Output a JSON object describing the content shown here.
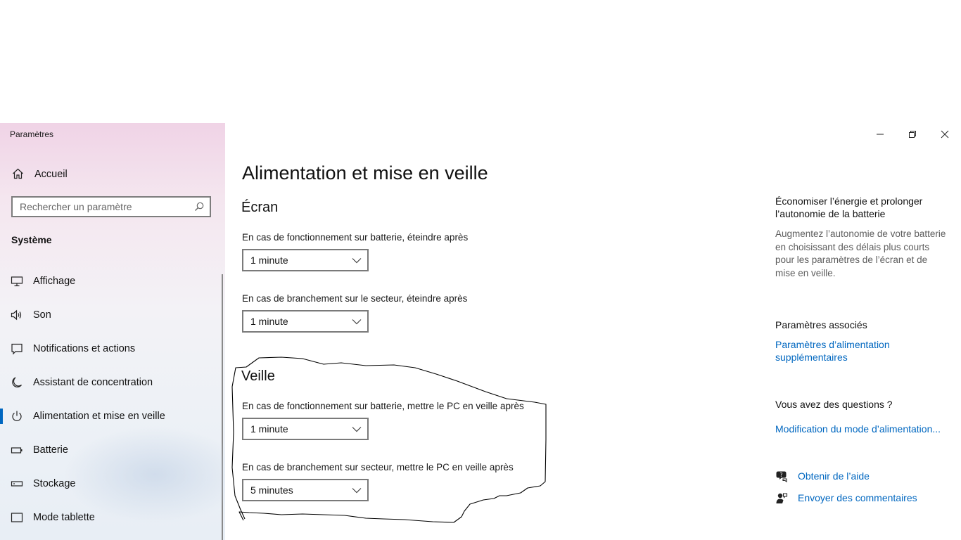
{
  "window": {
    "title": "Paramètres"
  },
  "sidebar": {
    "home_label": "Accueil",
    "search_placeholder": "Rechercher un paramètre",
    "section_label": "Système",
    "items": [
      {
        "label": "Affichage",
        "icon": "display-icon"
      },
      {
        "label": "Son",
        "icon": "speaker-icon"
      },
      {
        "label": "Notifications et actions",
        "icon": "notification-icon"
      },
      {
        "label": "Assistant de concentration",
        "icon": "moon-icon"
      },
      {
        "label": "Alimentation et mise en veille",
        "icon": "power-icon",
        "selected": true
      },
      {
        "label": "Batterie",
        "icon": "battery-icon"
      },
      {
        "label": "Stockage",
        "icon": "storage-icon"
      },
      {
        "label": "Mode tablette",
        "icon": "tablet-icon"
      }
    ]
  },
  "main": {
    "title": "Alimentation et mise en veille",
    "screen": {
      "heading": "Écran",
      "battery_label": "En cas de fonctionnement sur batterie, éteindre après",
      "battery_value": "1 minute",
      "plugged_label": "En cas de branchement sur le secteur, éteindre après",
      "plugged_value": "1 minute"
    },
    "sleep": {
      "heading": "Veille",
      "battery_label": "En cas de fonctionnement sur batterie, mettre le PC en veille après",
      "battery_value": "1 minute",
      "plugged_label": "En cas de branchement sur secteur, mettre le PC en veille après",
      "plugged_value": "5 minutes"
    }
  },
  "right_panel": {
    "tip_title": "Économiser l’énergie et prolonger l’autonomie de la batterie",
    "tip_desc": "Augmentez l’autonomie de votre batterie en choisissant des délais plus courts pour les paramètres de l’écran et de mise en veille.",
    "related_heading": "Paramètres associés",
    "related_link": "Paramètres d’alimentation supplémentaires",
    "questions_heading": "Vous avez des questions ?",
    "questions_link": "Modification du mode d’alimentation...",
    "help_label": "Obtenir de l’aide",
    "feedback_label": "Envoyer des commentaires"
  },
  "colors": {
    "accent": "#0067c0",
    "annotation": "#000000"
  }
}
